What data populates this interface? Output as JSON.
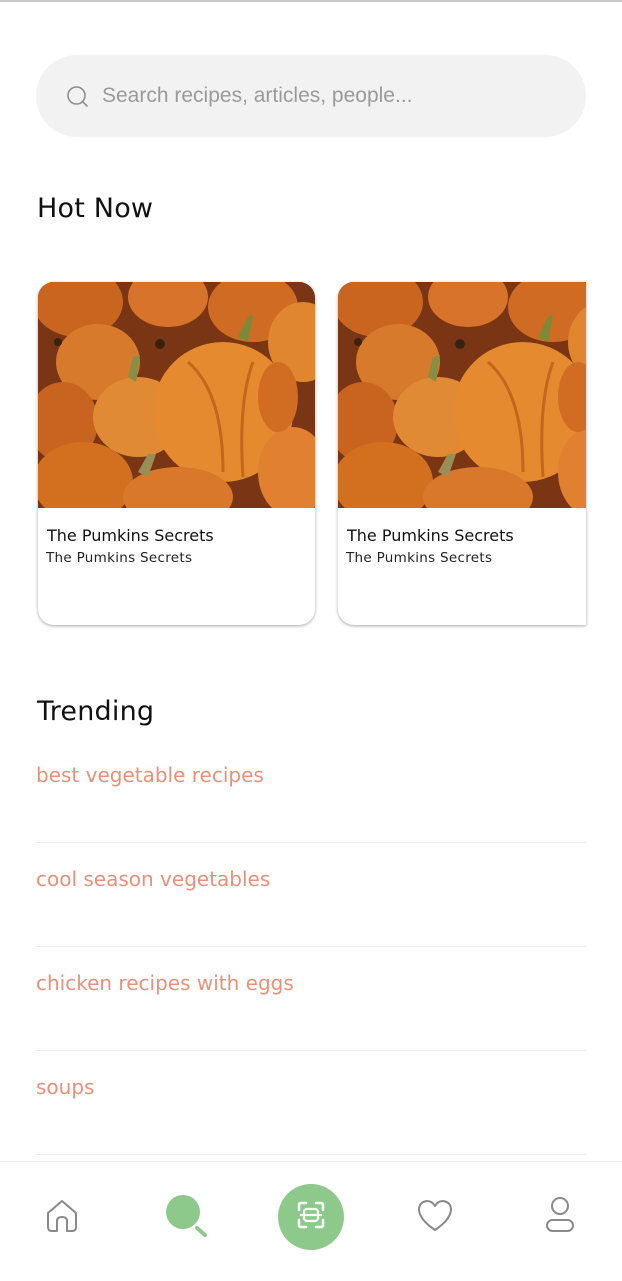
{
  "search": {
    "placeholder": "Search recipes, articles, people..."
  },
  "hot_now": {
    "title": "Hot Now",
    "cards": [
      {
        "title": "The Pumkins Secrets",
        "subtitle": "The Pumkins Secrets"
      },
      {
        "title": "The Pumkins Secrets",
        "subtitle": "The Pumkins Secrets"
      }
    ]
  },
  "trending": {
    "title": "Trending",
    "items": [
      "best vegetable recipes",
      "cool season vegetables",
      "chicken recipes with eggs",
      "soups"
    ]
  },
  "nav": {
    "items": [
      {
        "icon": "home-icon",
        "active": false
      },
      {
        "icon": "search-icon",
        "active": true
      },
      {
        "icon": "scan-icon",
        "active": false
      },
      {
        "icon": "heart-icon",
        "active": false
      },
      {
        "icon": "profile-icon",
        "active": false
      }
    ]
  },
  "colors": {
    "accent_green": "#8dc98a",
    "trending_text": "#e8917a",
    "search_bg": "#f2f2f2"
  }
}
